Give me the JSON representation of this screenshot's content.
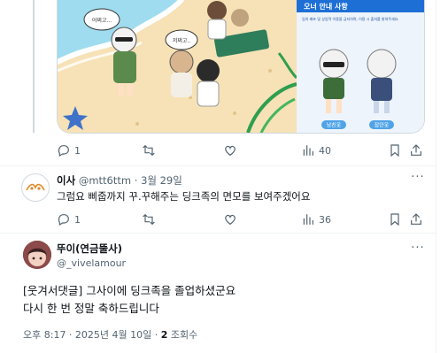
{
  "media_tweet": {
    "image": {
      "panel_title": "오너 안내 사항",
      "panel_notice": "임의 배포 및 상업적 이용을 금지하며, 이용 시 출처를 밝혀주세요.",
      "bubble_1": "어쩌고...",
      "bubble_2": "저쩌고..",
      "tag_left": "남친옷",
      "tag_right": "잠만옷"
    },
    "actions": {
      "reply_count": "1",
      "retweet_count": "",
      "like_count": "40"
    }
  },
  "reply_tweet": {
    "display_name": "이사",
    "handle": "@mtt6ttm",
    "separator": "·",
    "date": "3월 29일",
    "text": "그럼요 삐줍까지 꾸.꾸해주는 딩크족의 면모를 보여주겠어요",
    "actions": {
      "reply_count": "1",
      "retweet_count": "",
      "like_count": "36"
    }
  },
  "main_tweet": {
    "display_name": "뚜이(연금뚤사)",
    "handle": "@_vivelamour",
    "text_line_1": "[웃겨서댓글] 그사이에 딩크족을 졸업하셨군요",
    "text_line_2": "다시 한 번 정말 축하드립니다",
    "timestamp": "오후 8:17 · 2025년 4월 10일 · ",
    "views_count": "2",
    "views_label": " 조회수"
  },
  "colors": {
    "secondary_text": "#536471",
    "border": "#eff3f4",
    "panel_blue": "#1d6fd6",
    "sand": "#f6e2b6",
    "sea": "#9fdcef"
  }
}
